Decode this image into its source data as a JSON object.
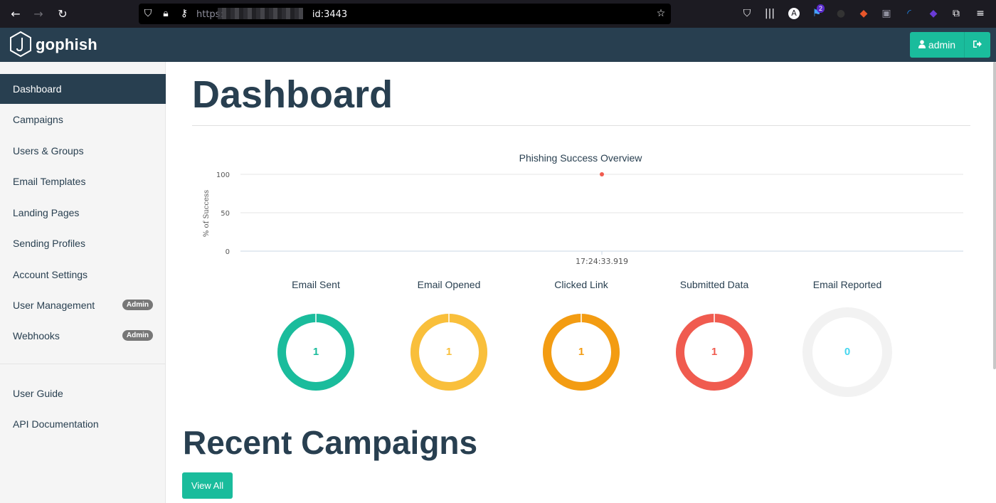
{
  "browser": {
    "url_prefix": "https:",
    "url_suffix": "id:3443",
    "extension_badge": "2"
  },
  "app": {
    "brand": "gophish",
    "user_label": "admin"
  },
  "sidebar": {
    "items": [
      {
        "label": "Dashboard",
        "active": true
      },
      {
        "label": "Campaigns"
      },
      {
        "label": "Users & Groups"
      },
      {
        "label": "Email Templates"
      },
      {
        "label": "Landing Pages"
      },
      {
        "label": "Sending Profiles"
      },
      {
        "label": "Account Settings"
      },
      {
        "label": "User Management",
        "badge": "Admin"
      },
      {
        "label": "Webhooks",
        "badge": "Admin"
      }
    ],
    "links": [
      {
        "label": "User Guide"
      },
      {
        "label": "API Documentation"
      }
    ]
  },
  "main": {
    "title": "Dashboard",
    "section_title": "Recent Campaigns",
    "view_all": "View All"
  },
  "chart_data": {
    "type": "line",
    "title": "Phishing Success Overview",
    "ylabel": "% of Success",
    "xlabel": "",
    "ylim": [
      0,
      100
    ],
    "yticks": [
      "0",
      "50",
      "100"
    ],
    "x": [
      "17:24:33.919"
    ],
    "series": [
      {
        "values": [
          100
        ],
        "color": "#f05b4f"
      }
    ],
    "grid": true
  },
  "stats": [
    {
      "label": "Email Sent",
      "value": "1",
      "percent": 100,
      "color": "#1abc9c"
    },
    {
      "label": "Email Opened",
      "value": "1",
      "percent": 100,
      "color": "#f9bf3b"
    },
    {
      "label": "Clicked Link",
      "value": "1",
      "percent": 100,
      "color": "#f39c12"
    },
    {
      "label": "Submitted Data",
      "value": "1",
      "percent": 100,
      "color": "#f05b4f"
    },
    {
      "label": "Email Reported",
      "value": "0",
      "percent": 0,
      "color": "#45d6ef"
    }
  ]
}
